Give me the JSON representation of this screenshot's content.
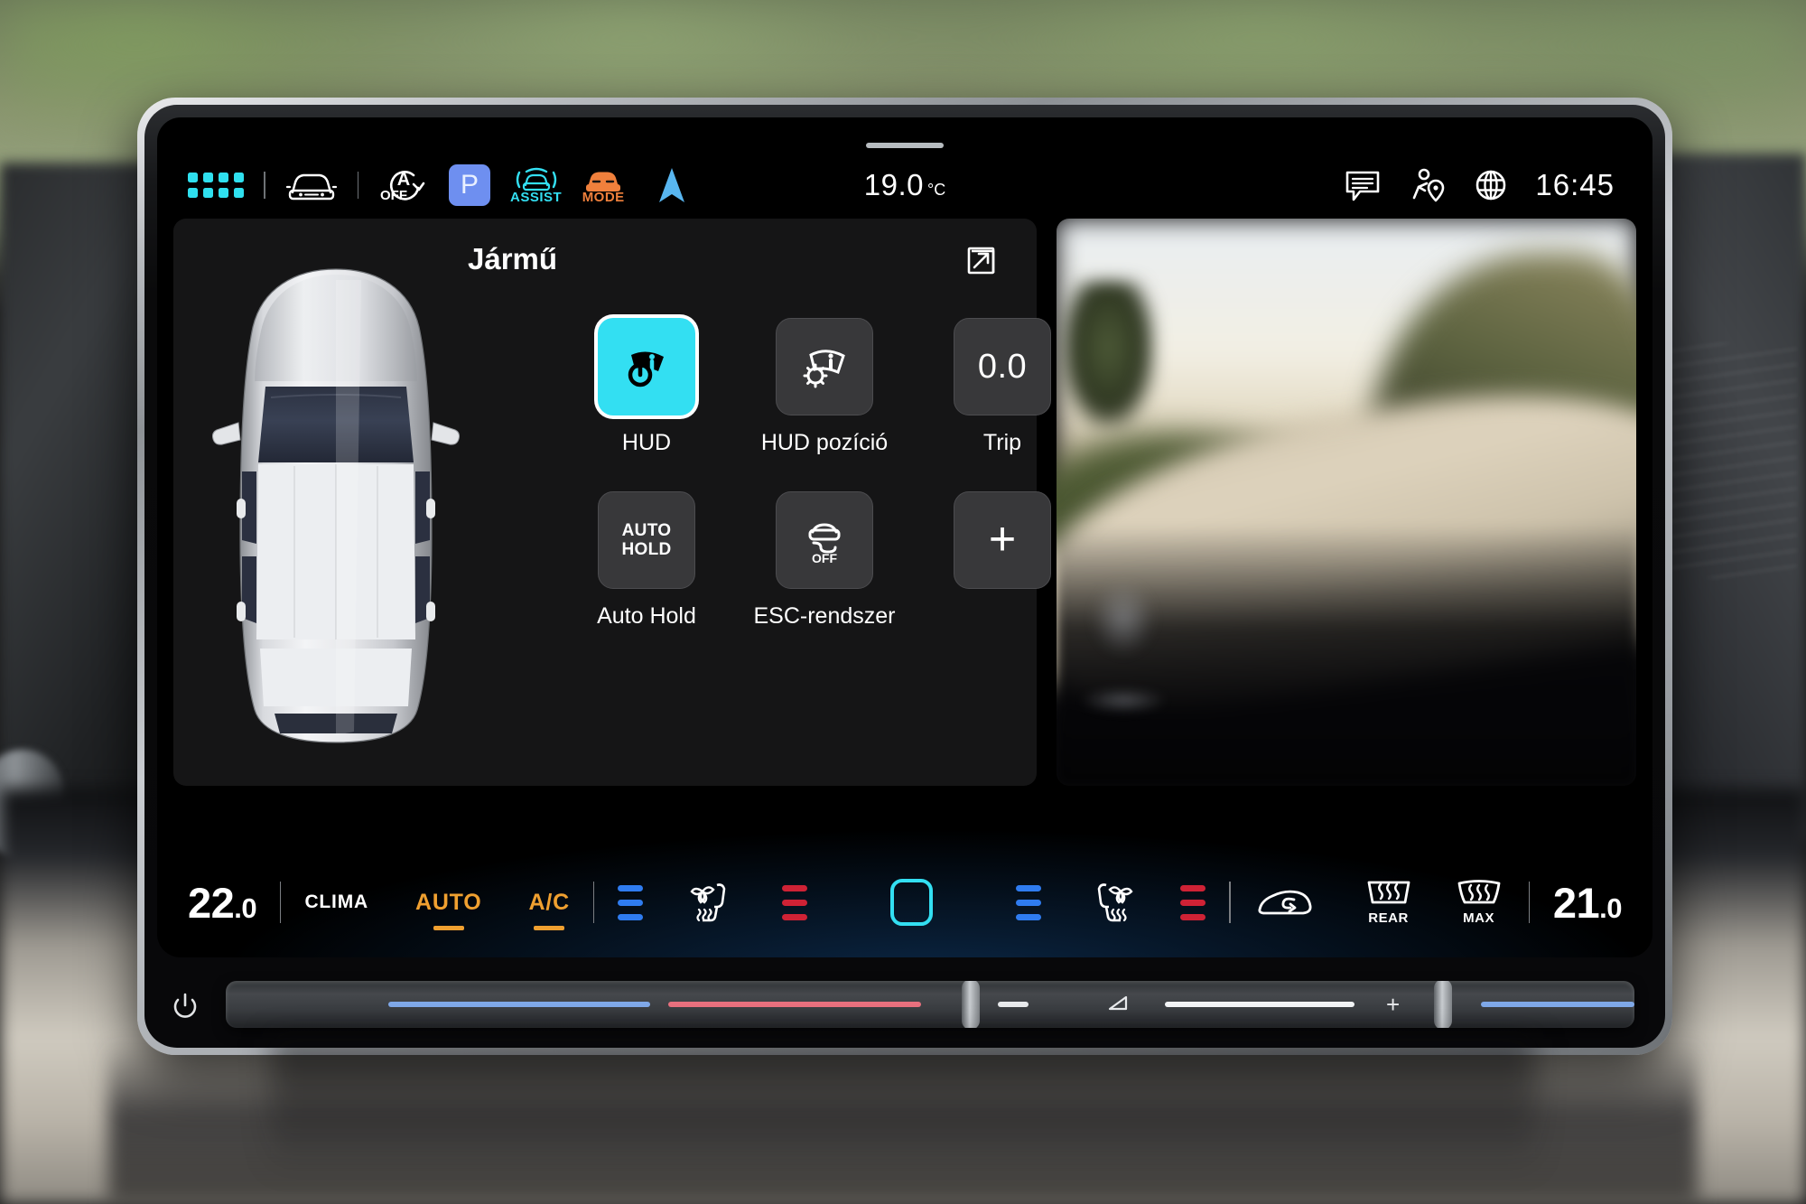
{
  "statusbar": {
    "apps_icon": "apps-grid-icon",
    "car_front_icon": "car-front-icon",
    "start_stop": {
      "letter": "A",
      "label": "OFF"
    },
    "park": {
      "label": "P"
    },
    "assist": {
      "label": "ASSIST"
    },
    "drive_mode": {
      "label": "MODE"
    },
    "nav_icon": "navigation-arrow-icon",
    "outside_temp": {
      "value": "19.0",
      "unit": "°C"
    },
    "message_icon": "message-bubble-icon",
    "traffic_icon": "person-location-icon",
    "globe_icon": "globe-icon",
    "clock": "16:45"
  },
  "vehicle_panel": {
    "title": "Jármű",
    "expand_icon": "expand-arrow-icon",
    "car_illustration": "car-top-view-image",
    "tiles": [
      {
        "id": "hud",
        "label": "HUD",
        "icon": "hud-power-icon",
        "active": true
      },
      {
        "id": "hud-position",
        "label": "HUD pozíció",
        "icon": "hud-settings-icon",
        "active": false
      },
      {
        "id": "trip",
        "label": "Trip",
        "value": "0.0",
        "icon": "trip-value",
        "active": false
      },
      {
        "id": "auto-hold",
        "label": "Auto Hold",
        "icon": "auto-hold-icon",
        "text_line1": "AUTO",
        "text_line2": "HOLD",
        "active": false
      },
      {
        "id": "esc",
        "label": "ESC-rendszer",
        "icon": "esc-off-icon",
        "icon_label": "OFF",
        "active": false
      },
      {
        "id": "add",
        "label": "",
        "icon": "plus-icon",
        "active": false
      }
    ]
  },
  "media_panel": {
    "image": "road-sunset-photo"
  },
  "climate": {
    "left_temp": {
      "whole": "22",
      "frac": ".0"
    },
    "clima_label": "CLIMA",
    "auto_label": "AUTO",
    "ac_label": "A/C",
    "left_fan_icon": "seat-climate-left-icon",
    "right_fan_icon": "seat-climate-right-icon",
    "sync_icon": "sync-square-icon",
    "recirculation_icon": "air-recirculation-icon",
    "rear_defrost": {
      "icon": "rear-defrost-icon",
      "label": "REAR"
    },
    "front_defrost": {
      "icon": "front-defrost-icon",
      "label": "MAX"
    },
    "right_temp": {
      "whole": "21",
      "frac": ".0"
    }
  },
  "hardware_strip": {
    "power_icon": "power-button-icon",
    "volume_minus_icon": "volume-low-icon",
    "volume_plus_icon": "plus-icon",
    "left_handle": "temperature-slider-handle-left",
    "right_handle": "volume-slider-handle-right"
  },
  "colors": {
    "accent_cyan": "#33dff2",
    "accent_orange": "#f0a030",
    "accent_blue": "#6e8ff0",
    "bar_blue": "#2f7cf0",
    "bar_red": "#cf2235",
    "panel_bg": "#151516",
    "tile_bg": "#38383a"
  }
}
